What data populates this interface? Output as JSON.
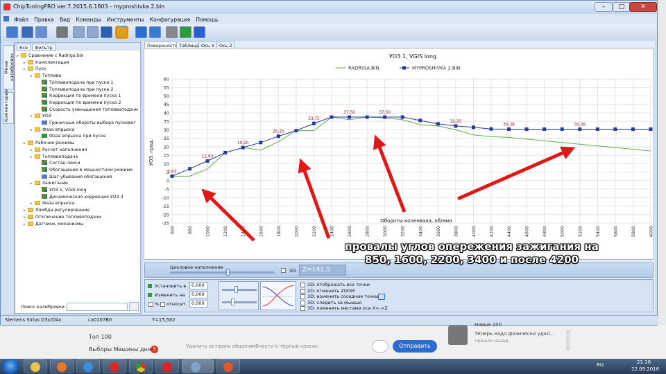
{
  "window": {
    "title": "ChipTuningPRO ver.7.2015.6.1803 - myproshivka 2.bin",
    "controls": [
      "–",
      "□",
      "✕"
    ]
  },
  "menu": [
    "Файл",
    "Правка",
    "Вид",
    "Команды",
    "Инструменты",
    "Конфигурация",
    "Помощь"
  ],
  "toolbar_icons": [
    "open-icon",
    "save-icon",
    "save-as-icon",
    "print-icon",
    "copy-icon",
    "paste-icon",
    "undo-icon",
    "compare-icon",
    "checksum-icon",
    "zoom-icon",
    "tools-icon",
    "refresh-icon",
    "help-icon"
  ],
  "left_strip": {
    "tab_calibrations": "Меню калибровок",
    "tab_comments": "Комментарии"
  },
  "tree_tabs": [
    "Все",
    "Фильтр"
  ],
  "tree": [
    {
      "label": "Сравнение с Radriga.bin",
      "level": 0,
      "icon": "folder"
    },
    {
      "label": "Комплектация",
      "level": 1,
      "icon": "folder"
    },
    {
      "label": "Пуск",
      "level": 1,
      "icon": "folder"
    },
    {
      "label": "Топливо",
      "level": 2,
      "icon": "folder"
    },
    {
      "label": "Топливоподача при пуске 1",
      "level": 3,
      "icon": "map"
    },
    {
      "label": "Топливоподача при пуске 2",
      "level": 3,
      "icon": "map"
    },
    {
      "label": "Коррекция по времени пуска 1",
      "level": 3,
      "icon": "map"
    },
    {
      "label": "Коррекция по времени пуска 2",
      "level": 3,
      "icon": "map"
    },
    {
      "label": "Скорость уменьшения топливоподачи",
      "level": 3,
      "icon": "map"
    },
    {
      "label": "УОЗ",
      "level": 2,
      "icon": "folder"
    },
    {
      "label": "Граничные обороты выбора пусковог",
      "level": 3,
      "icon": "chart"
    },
    {
      "label": "Фаза впрыска",
      "level": 2,
      "icon": "folder"
    },
    {
      "label": "Фаза впрыска при пуске",
      "level": 3,
      "icon": "check"
    },
    {
      "label": "Рабочие режимы",
      "level": 1,
      "icon": "folder"
    },
    {
      "label": "Расчет наполнения",
      "level": 2,
      "icon": "folder"
    },
    {
      "label": "Топливоподача",
      "level": 2,
      "icon": "folder"
    },
    {
      "label": "Состав смеси",
      "level": 3,
      "icon": "map"
    },
    {
      "label": "Обогащение в мощностном режиме",
      "level": 3,
      "icon": "map"
    },
    {
      "label": "Шаг убывания обогащения",
      "level": 3,
      "icon": "chart"
    },
    {
      "label": "Зажигание",
      "level": 2,
      "icon": "folder"
    },
    {
      "label": "УОЗ 1, VGIS long",
      "level": 3,
      "icon": "map"
    },
    {
      "label": "Динамическая коррекция УОЗ 3",
      "level": 3,
      "icon": "map"
    },
    {
      "label": "Фаза впрыска",
      "level": 2,
      "icon": "folder"
    },
    {
      "label": "Лямбда-регулирование",
      "level": 1,
      "icon": "folder"
    },
    {
      "label": "Отключение топливоподачи",
      "level": 1,
      "icon": "folder"
    },
    {
      "label": "Датчики, механизмы",
      "level": 1,
      "icon": "folder"
    }
  ],
  "search": {
    "label": "Поиск калибровки",
    "placeholder": ""
  },
  "right_tabs": [
    "Поверхность",
    "Таблица",
    "Ось X",
    "Ось Z"
  ],
  "chart_data": {
    "type": "line",
    "title": "УОЗ 1, VGIS long",
    "xlabel": "Обороты коленвала, об/мин",
    "ylabel": "УОЗ, град.",
    "x": [
      600,
      850,
      1000,
      1200,
      1400,
      1600,
      1800,
      2000,
      2200,
      2400,
      2600,
      2800,
      3000,
      3200,
      3400,
      3600,
      3800,
      4000,
      4200,
      4400,
      4600,
      4800,
      5000,
      5200,
      5400,
      5600,
      5800,
      6000
    ],
    "xtick_labels": [
      "600",
      "850",
      "1000",
      "1200",
      "1400",
      "1600",
      "1800",
      "2000",
      "2200",
      "2400",
      "2600",
      "2800",
      "3000",
      "3200",
      "3400",
      "3600",
      "3800",
      "4000",
      "4200",
      "4400",
      "4600",
      "4800",
      "5000",
      "5200",
      "5400",
      "5600",
      "5800",
      "6000"
    ],
    "ylim": [
      -25,
      60
    ],
    "yticks": [
      -25,
      -20,
      -15,
      -10,
      -5,
      0,
      5,
      10,
      15,
      20,
      25,
      30,
      35,
      40,
      45,
      50,
      55,
      60
    ],
    "grid": true,
    "legend_position": "top",
    "series": [
      {
        "name": "RADRIGA.BIN",
        "color": "#5cb04a",
        "marker": "none",
        "values": [
          2.63,
          2.63,
          7.0,
          16.5,
          19.5,
          18.0,
          23.0,
          29.5,
          29.5,
          37.5,
          36.0,
          37.5,
          37.0,
          36.0,
          33.0,
          32.25,
          30.0,
          27.0,
          26.0,
          25.5,
          24.5,
          23.5,
          22.5,
          21.5,
          20.5,
          19.5,
          18.5,
          17.5
        ]
      },
      {
        "name": "MYPROSHIVKA 2.BIN",
        "color": "#2a3a9a",
        "marker": "square",
        "values": [
          2.63,
          7.0,
          11.63,
          16.5,
          19.5,
          22.5,
          26.25,
          29.5,
          33.75,
          37.5,
          37.5,
          37.5,
          37.5,
          37.5,
          35.5,
          33.5,
          32.25,
          31.5,
          30.5,
          30.38,
          30.38,
          30.38,
          30.38,
          30.38,
          30.38,
          30.38,
          30.38,
          30.38
        ]
      }
    ],
    "point_labels": [
      {
        "series": 1,
        "index": 0,
        "text": "2,63"
      },
      {
        "series": 1,
        "index": 2,
        "text": "11,63"
      },
      {
        "series": 1,
        "index": 4,
        "text": "19,50"
      },
      {
        "series": 1,
        "index": 6,
        "text": "26,25"
      },
      {
        "series": 1,
        "index": 8,
        "text": "33,75"
      },
      {
        "series": 1,
        "index": 10,
        "text": "37,50"
      },
      {
        "series": 1,
        "index": 12,
        "text": "37,50"
      },
      {
        "series": 1,
        "index": 16,
        "text": "32,25"
      },
      {
        "series": 1,
        "index": 19,
        "text": "30,38"
      },
      {
        "series": 1,
        "index": 23,
        "text": "30,38"
      }
    ]
  },
  "controls_top": {
    "fill_label": "Цикловое наполнение",
    "fill_level": 0.55,
    "z_readout": "Z=141,5",
    "check_3d": "3D"
  },
  "controls_bottom": {
    "set_label": "Установить в",
    "change_label": "Изменить на",
    "percent_label": "%",
    "relative_label": "относит.",
    "set_value": "0,000",
    "change_value": "0,000",
    "relative_value": "0,000",
    "slider1_level": 0.4,
    "slider2_level": 0.3,
    "options": [
      "2D: отображать все точки",
      "2D: отменить ZOOM",
      "3D: изменить соседние точки",
      "3D: следить за мышью",
      "3D: поменять местами оси X<->Z"
    ]
  },
  "status": {
    "ecu": "Siemens Sirius D3x/D4x",
    "id": "ca0107B0",
    "y": "Y=15,502"
  },
  "browser": {
    "top100": "Топ 100",
    "vybory": "Выборы Машины дня",
    "badge": "3",
    "delete_history": "Удалить историю общения",
    "blacklist": "Внести в Чёрный список",
    "send": "Отправить",
    "msg_title": "Новые 100",
    "msg_text": "Теперь надо физически удал...",
    "msg_time": "прошло назад"
  },
  "tray": {
    "lang": "RU",
    "time": "21:16",
    "date": "22.09.2016"
  },
  "annotation": {
    "line1": "провалы углов опережения зажигания на",
    "line2": "850, 1600, 2200, 3400 и после 4200"
  },
  "colors": {
    "arrow": "#e01818",
    "accent": "#3a6fc4",
    "send_button": "#2e6bd0"
  }
}
